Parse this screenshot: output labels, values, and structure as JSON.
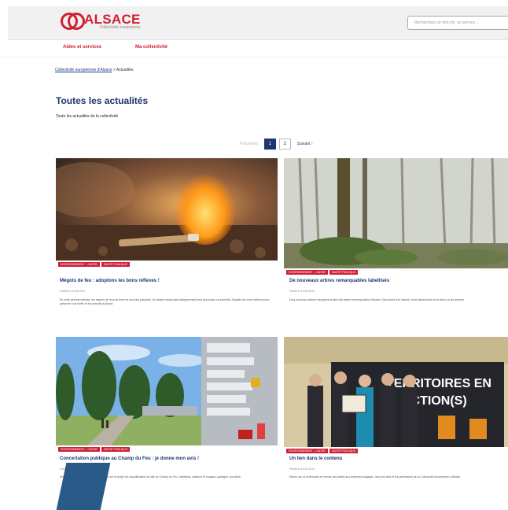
{
  "header": {
    "logo_text": "ALSACE",
    "logo_sub": "Collectivité européenne",
    "search_placeholder": "Recherchez un mot-clé, un service..."
  },
  "nav": {
    "items": [
      "Aides et services",
      "Ma collectivité"
    ]
  },
  "breadcrumb": {
    "home": "Collectivité européenne d'Alsace",
    "separator": ">",
    "current": "Actualités"
  },
  "page": {
    "title": "Toutes les actualités",
    "subtitle": "Toute les actualités de la collectivité"
  },
  "pagination": {
    "prev": "Précédent",
    "pages": [
      "1",
      "2"
    ],
    "active": "1",
    "next": "Suivant"
  },
  "cards": [
    {
      "tags": [
        "ENVIRONNEMENT – CADRE",
        "SANTÉ PUBLIQUE"
      ],
      "title": "Mégots de feu : adoptons les bons réflexes !",
      "date": "Publié le 21.08.2024",
      "text": "En cette période estivale, les risques de feux de forêt se font plus présents. Un simple mégot jeté négligemment peut provoquer un incendie. Adoptez les bons réflexes pour préserver nos forêts et les massifs d'Alsace."
    },
    {
      "tags": [
        "ENVIRONNEMENT – CADRE",
        "SANTÉ PUBLIQUE"
      ],
      "title": "De nouveaux arbres remarquables labellisés",
      "date": "Publié le 14.08.2024",
      "text": "Cinq nouveaux arbres rejoignent la liste des arbres remarquables d'Alsace. Découvrez leur histoire, leurs dimensions et les lieux où les admirer."
    },
    {
      "tags": [
        "ENVIRONNEMENT – CADRE",
        "SANTÉ PUBLIQUE"
      ],
      "title": "Concertation publique au Champ du Feu : je donne mon avis !",
      "date": "Publié le 07.08.2024",
      "text": "Une concertation publique est organisée sur le projet de requalification du site du Champ du Feu. Habitants, visiteurs et usagers, partagez vos idées."
    },
    {
      "tags": [
        "ENVIRONNEMENT – CADRE",
        "SANTÉ PUBLIQUE"
      ],
      "title": "Un lien dans le contenu",
      "date": "Publié le 01.08.2024",
      "text": "Retour sur la cérémonie de remise des labels aux territoires engagés, avec les élus et les partenaires de la Collectivité européenne d'Alsace."
    }
  ],
  "colors": {
    "brand_red": "#d01f34",
    "brand_blue": "#1d3570"
  }
}
